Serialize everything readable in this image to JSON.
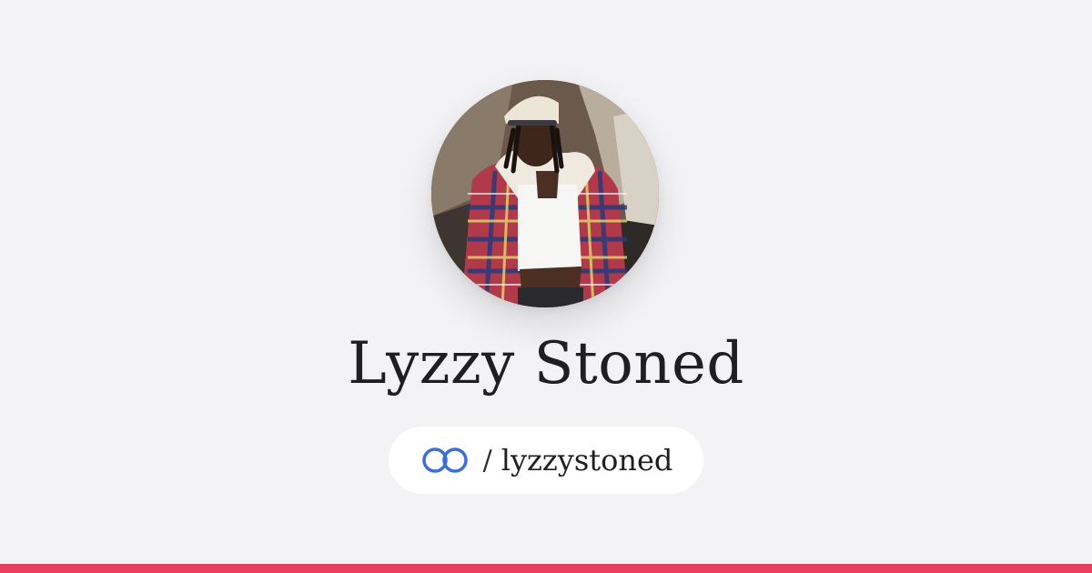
{
  "profile": {
    "name": "Lyzzy Stoned",
    "separator": "/",
    "handle": "lyzzystoned"
  },
  "icons": {
    "logo": "linked-rings-icon",
    "avatar": "profile-photo"
  },
  "colors": {
    "background": "#f3f3f5",
    "accent_bar": "#e83e5f",
    "logo_blue": "#3b6fd6",
    "pill": "#ffffff",
    "text": "#1f1f22"
  }
}
